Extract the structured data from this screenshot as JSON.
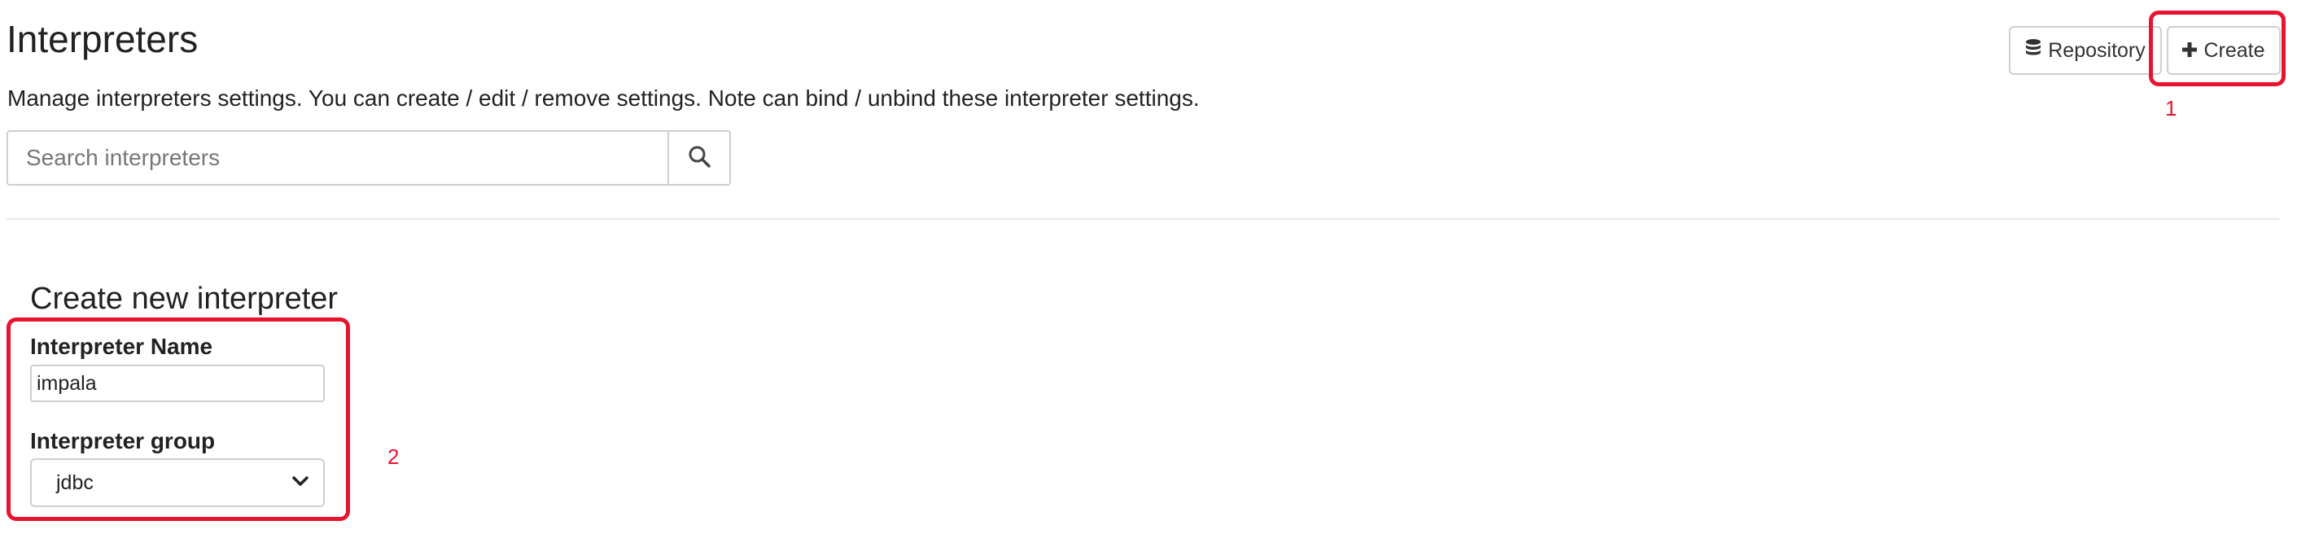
{
  "header": {
    "title": "Interpreters",
    "description": "Manage interpreters settings. You can create / edit / remove settings. Note can bind / unbind these interpreter settings."
  },
  "toolbar": {
    "repository_label": "Repository",
    "repository_icon": "database-icon",
    "create_label": "Create",
    "create_icon": "plus-icon"
  },
  "search": {
    "placeholder": "Search interpreters",
    "value": "",
    "icon": "search-icon"
  },
  "create_form": {
    "title": "Create new interpreter",
    "name_label": "Interpreter Name",
    "name_value": "impala",
    "group_label": "Interpreter group",
    "group_value": "jdbc"
  },
  "annotations": {
    "marker_1": "1",
    "marker_2": "2",
    "color": "#e8132f"
  }
}
